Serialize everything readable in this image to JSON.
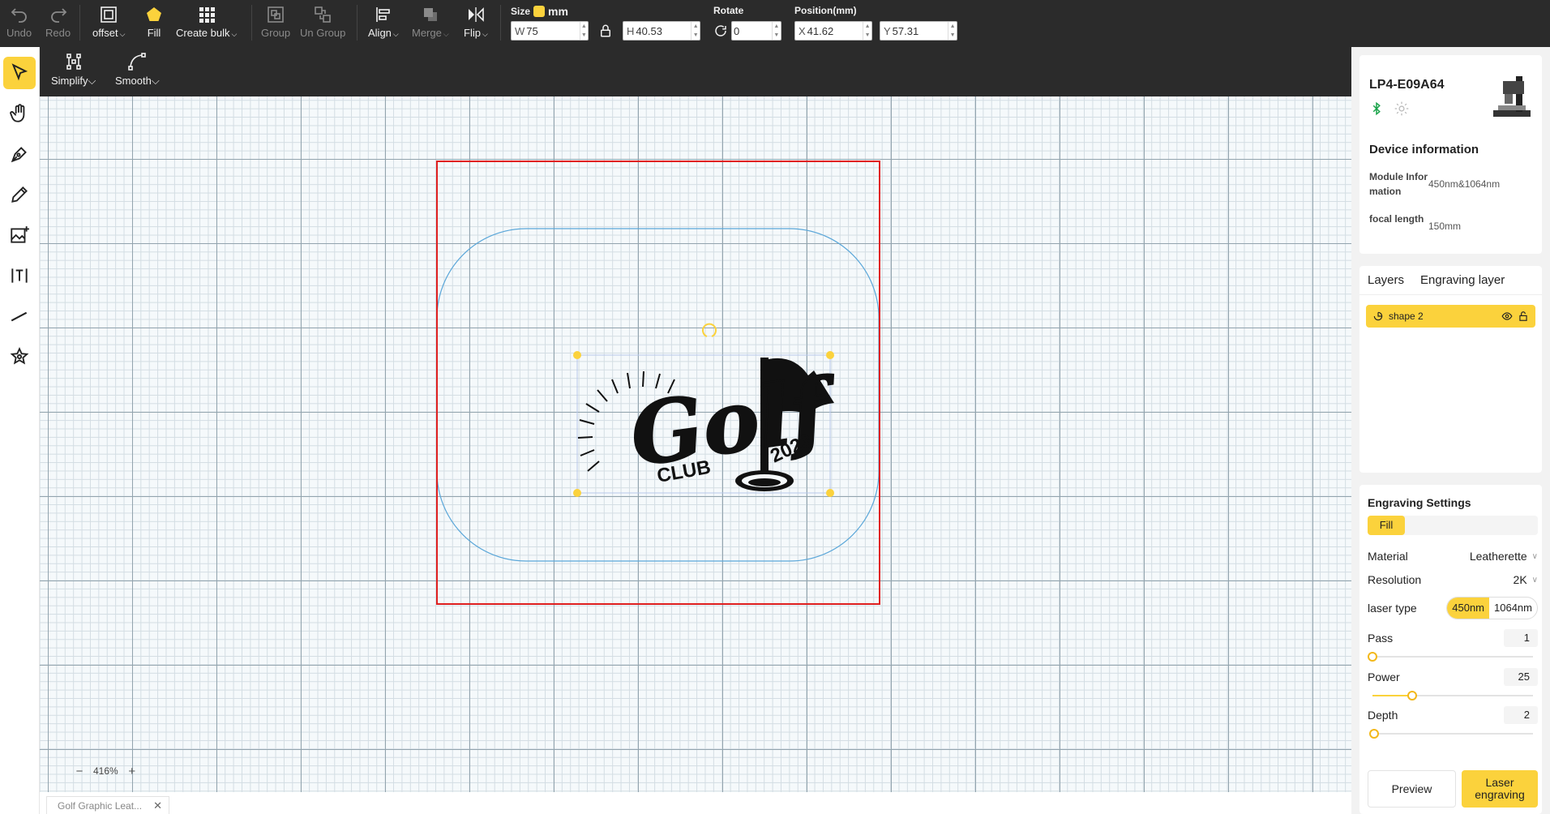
{
  "toolbar": {
    "undo": "Undo",
    "redo": "Redo",
    "offset": "offset",
    "fill": "Fill",
    "create_bulk": "Create bulk",
    "group": "Group",
    "ungroup": "Un Group",
    "align": "Align",
    "merge": "Merge",
    "flip": "Flip",
    "size_label": "Size",
    "unit": "mm",
    "width_prefix": "W",
    "width_value": "75",
    "height_prefix": "H",
    "height_value": "40.53",
    "rotate_label": "Rotate",
    "rotate_value": "0",
    "position_label": "Position(mm)",
    "x_prefix": "X",
    "x_value": "41.62",
    "y_prefix": "Y",
    "y_value": "57.31"
  },
  "subtoolbar": {
    "simplify": "Simplify",
    "smooth": "Smooth"
  },
  "left_tools": [
    "select-icon",
    "hand-icon",
    "pen-icon",
    "pencil-icon",
    "image-add-icon",
    "text-icon",
    "line-icon",
    "shapes-icon"
  ],
  "canvas": {
    "zoom": "416%",
    "artwork_text": {
      "main": "Golf",
      "sub": "CLUB",
      "year": "2023"
    }
  },
  "file_tab": {
    "name": "Golf Graphic Leat..."
  },
  "device": {
    "name": "LP4-E09A64",
    "info_title": "Device information",
    "module_label": "Module Information",
    "module_value": "450nm&1064nm",
    "focal_label": "focal length",
    "focal_value": "150mm"
  },
  "layers": {
    "tab_layers": "Layers",
    "tab_engraving": "Engraving layer",
    "items": [
      {
        "name": "shape 2"
      }
    ]
  },
  "engraving": {
    "title": "Engraving Settings",
    "mode": "Fill",
    "material_label": "Material",
    "material_value": "Leatherette",
    "resolution_label": "Resolution",
    "resolution_value": "2K",
    "laser_type_label": "laser type",
    "laser_opt_1": "450nm",
    "laser_opt_2": "1064nm",
    "pass_label": "Pass",
    "pass_value": "1",
    "power_label": "Power",
    "power_value": "25",
    "depth_label": "Depth",
    "depth_value": "2",
    "preview_btn": "Preview",
    "laser_btn": "Laser engraving"
  },
  "colors": {
    "accent": "#fbd23c",
    "toolbar_bg": "#2b2b2b",
    "work_area_border": "#e02020",
    "shape_outline": "#5ba7d9"
  }
}
